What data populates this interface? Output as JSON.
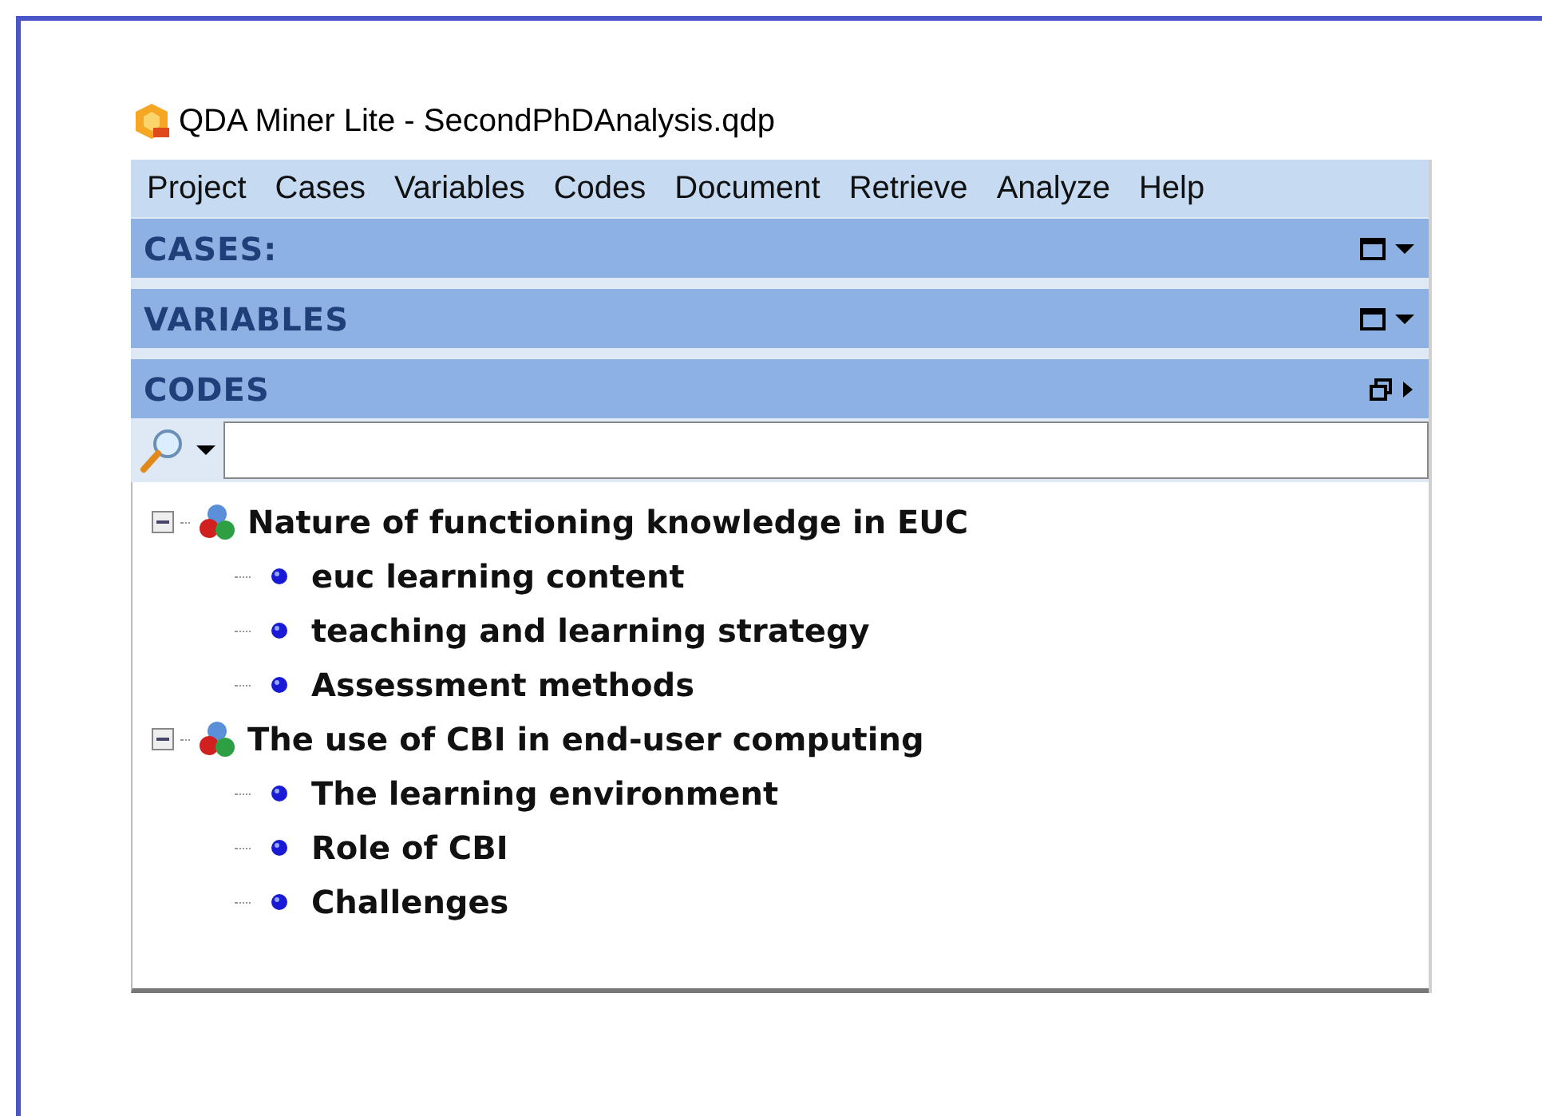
{
  "window": {
    "title": "QDA Miner Lite - SecondPhDAnalysis.qdp"
  },
  "menu": [
    "Project",
    "Cases",
    "Variables",
    "Codes",
    "Document",
    "Retrieve",
    "Analyze",
    "Help"
  ],
  "panels": [
    {
      "title": "CASES:",
      "expanded": false
    },
    {
      "title": "VARIABLES",
      "expanded": false
    },
    {
      "title": "CODES",
      "expanded": true
    }
  ],
  "codes_tree": [
    {
      "label": "Nature of functioning knowledge in EUC",
      "expanded": true,
      "children": [
        {
          "label": "euc learning content"
        },
        {
          "label": "teaching and learning strategy"
        },
        {
          "label": "Assessment methods"
        }
      ]
    },
    {
      "label": "The use of CBI in end-user computing",
      "expanded": true,
      "children": [
        {
          "label": "The learning environment"
        },
        {
          "label": "Role of CBI"
        },
        {
          "label": "Challenges"
        }
      ]
    }
  ]
}
